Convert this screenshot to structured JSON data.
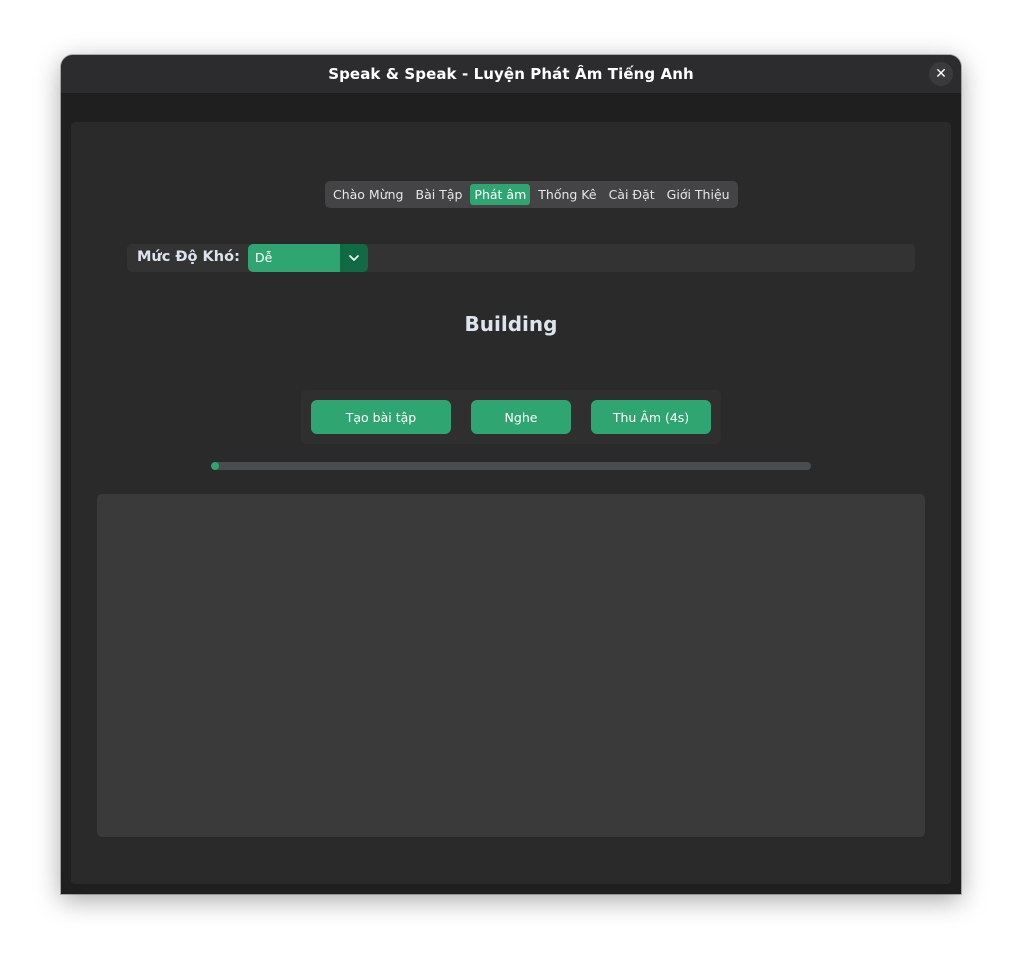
{
  "window": {
    "title": "Speak & Speak - Luyện Phát Âm Tiếng Anh",
    "close_icon": "close-icon",
    "close_glyph": "✕"
  },
  "tabs": [
    {
      "label": "Chào Mừng",
      "active": false
    },
    {
      "label": "Bài Tập",
      "active": false
    },
    {
      "label": "Phát âm",
      "active": true
    },
    {
      "label": "Thống Kê",
      "active": false
    },
    {
      "label": "Cài Đặt",
      "active": false
    },
    {
      "label": "Giới Thiệu",
      "active": false
    }
  ],
  "difficulty": {
    "label": "Mức Độ Khó:",
    "selected": "Dễ",
    "arrow_icon": "chevron-down-icon"
  },
  "exercise": {
    "word": "Building"
  },
  "buttons": {
    "generate": "Tạo bài tập",
    "listen": "Nghe",
    "record": "Thu Âm (4s)"
  },
  "progress": {
    "value": 0
  },
  "result": {
    "text": ""
  },
  "colors": {
    "accent": "#2fa572",
    "accent_dark": "#106a43",
    "background": "#1f1f1f",
    "panel": "#2a2a2a",
    "text": "#dce4ee"
  }
}
